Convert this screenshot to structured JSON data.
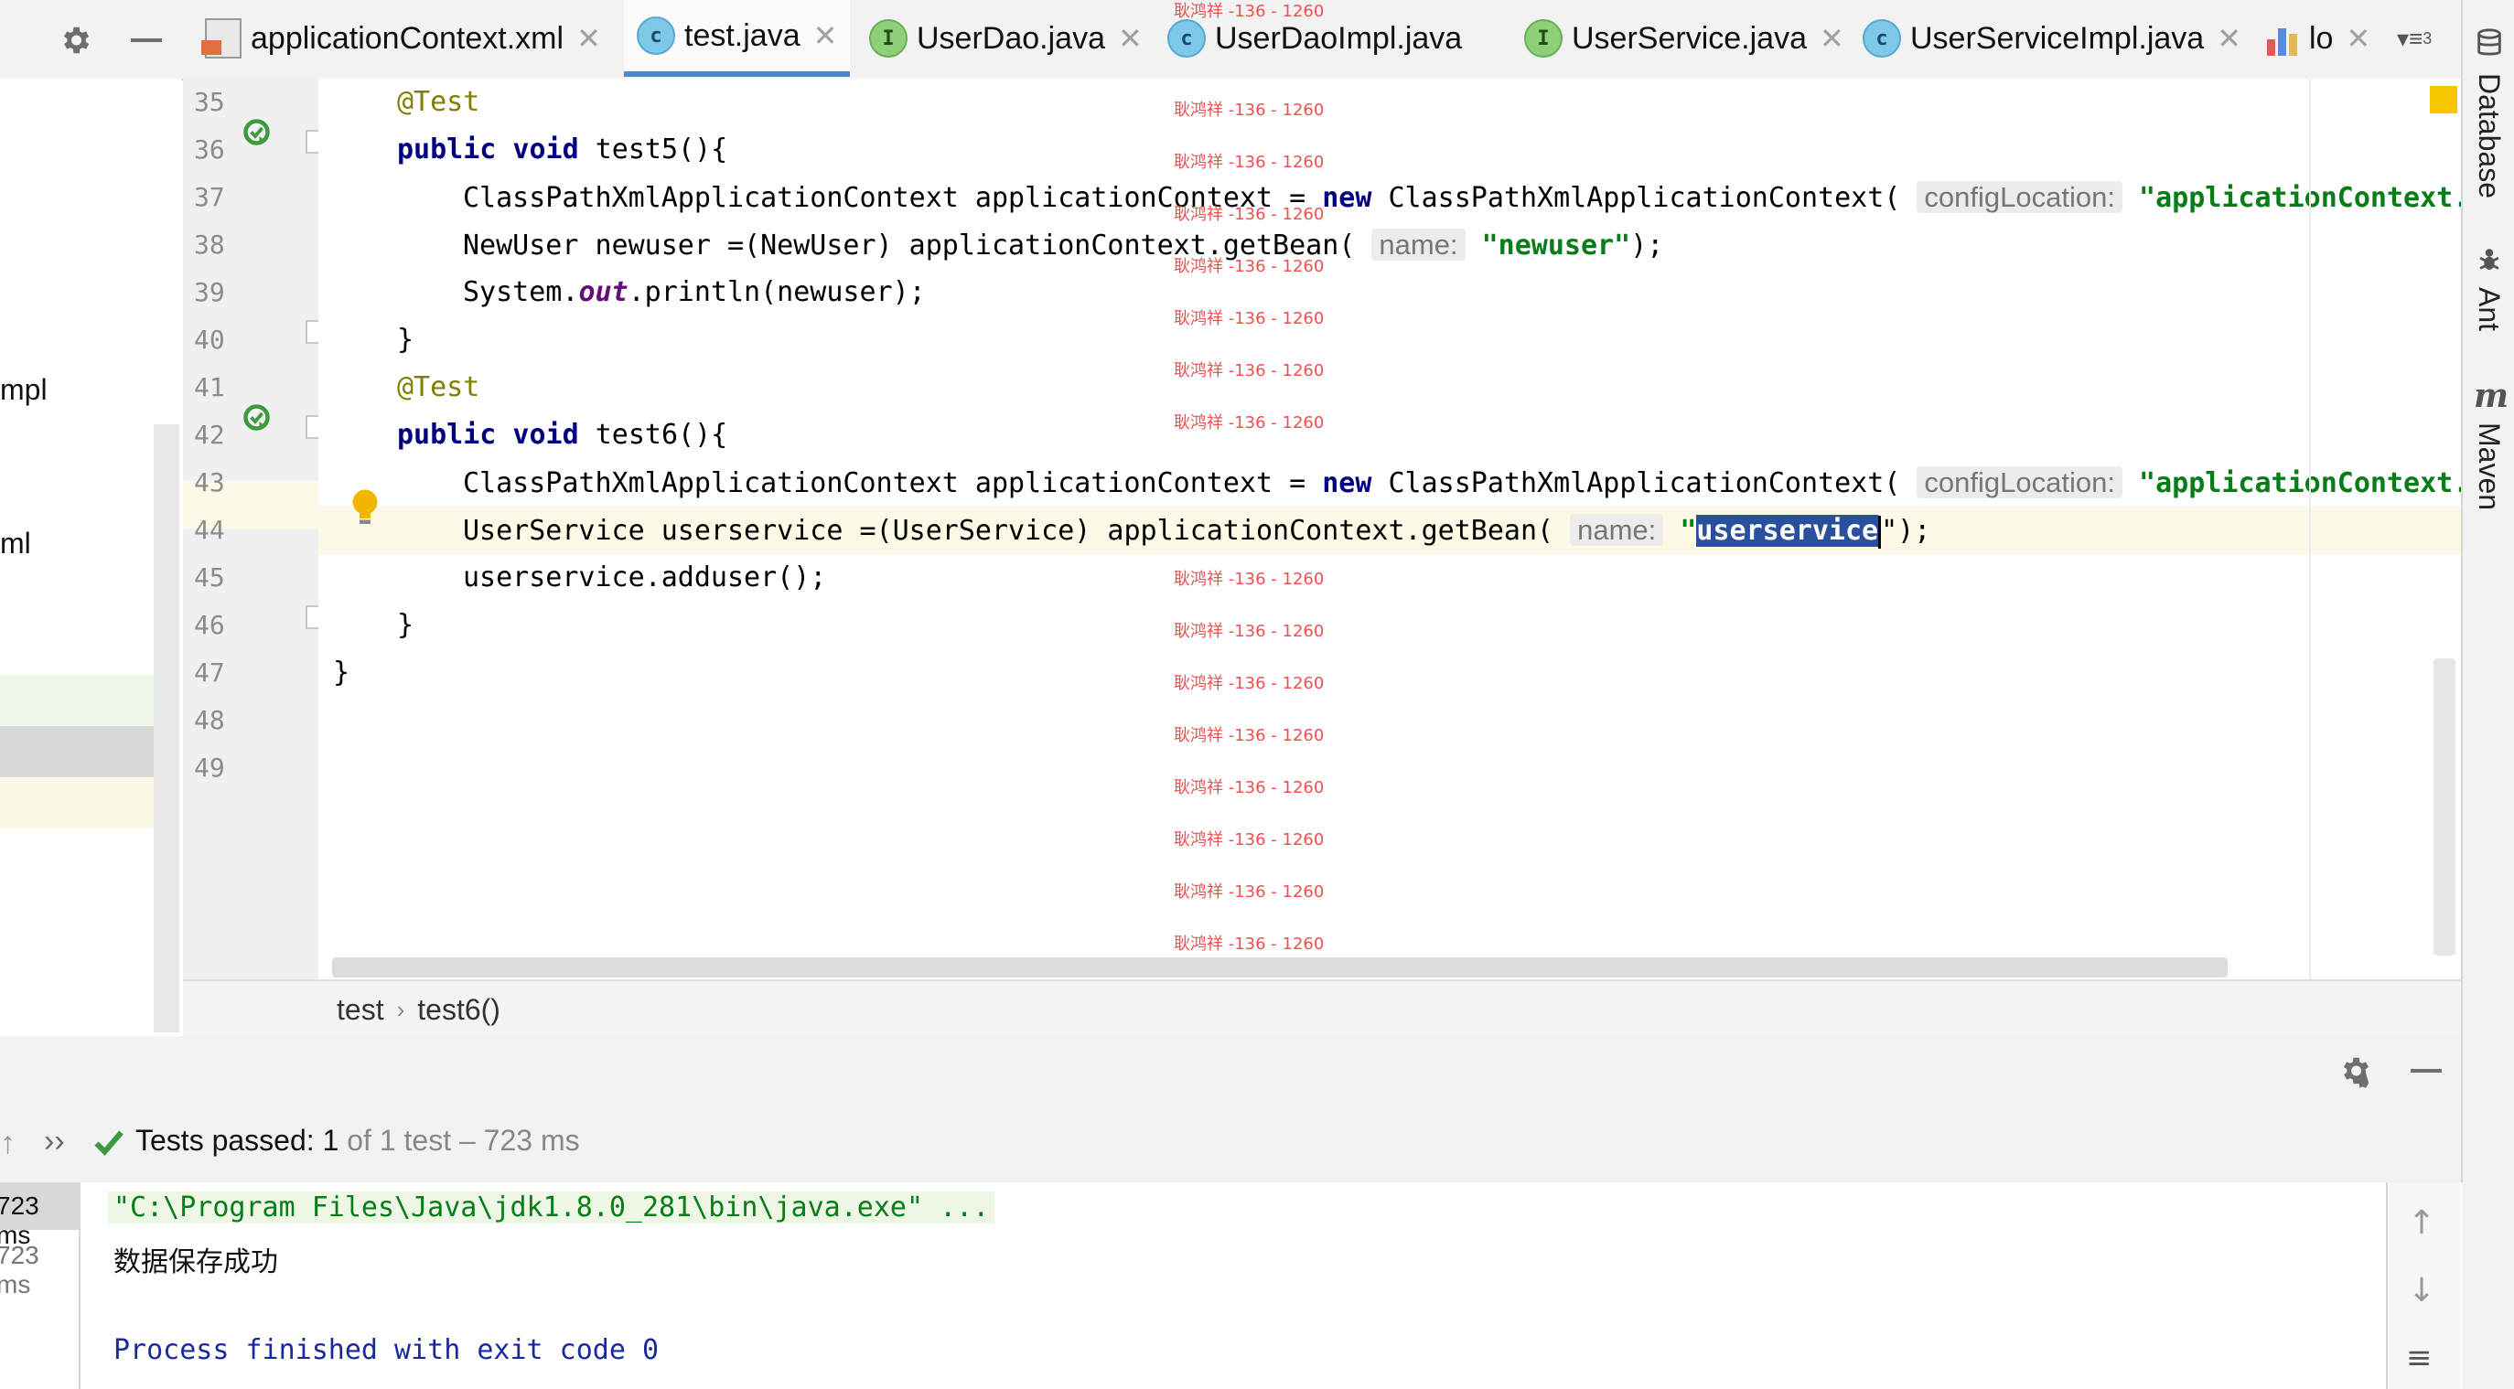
{
  "tabs": [
    {
      "label": "applicationContext.xml",
      "type": "xml"
    },
    {
      "label": "test.java",
      "type": "class",
      "active": true
    },
    {
      "label": "UserDao.java",
      "type": "interface"
    },
    {
      "label": "UserDaoImpl.java",
      "type": "class"
    },
    {
      "label": "UserService.java",
      "type": "interface"
    },
    {
      "label": "UserServiceImpl.java",
      "type": "class"
    },
    {
      "label": "lo",
      "type": "file"
    }
  ],
  "tab_overflow_count": "3",
  "project_fragments": [
    "mpl",
    "ml"
  ],
  "editor": {
    "line_numbers": [
      "35",
      "36",
      "37",
      "38",
      "39",
      "40",
      "41",
      "42",
      "43",
      "44",
      "45",
      "46",
      "47",
      "48",
      "49"
    ],
    "code": {
      "l35_ann": "@Test",
      "l36_kw": "public void",
      "l36_rest": " test5(){",
      "l37_a": "ClassPathXmlApplicationContext applicationContext = ",
      "l37_kw": "new",
      "l37_b": " ClassPathXmlApplicationContext( ",
      "l37_hint": "configLocation:",
      "l37_str": "\"applicationContext.",
      "l38_a": "NewUser newuser =(NewUser) applicationContext.getBean( ",
      "l38_hint": "name:",
      "l38_str": "\"newuser\"",
      "l38_end": ");",
      "l39_a": "System.",
      "l39_fld": "out",
      "l39_b": ".println(newuser);",
      "l40": "}",
      "l41_ann": "@Test",
      "l42_kw": "public void",
      "l42_rest": " test6(){",
      "l43_a": "ClassPathXmlApplicationContext applicationContext = ",
      "l43_kw": "new",
      "l43_b": " ClassPathXmlApplicationContext( ",
      "l43_hint": "configLocation:",
      "l43_str": "\"applicationContext.",
      "l44_a": "UserService userservice =(UserService) applicationContext.getBean( ",
      "l44_hint": "name:",
      "l44_q": "\"",
      "l44_sel": "userservice",
      "l44_end": "\");",
      "l45": "userservice.adduser();",
      "l46": "}",
      "l47": "}"
    },
    "watermark": "耿鸿祥 -136 - 1260"
  },
  "breadcrumb": {
    "class_name": "test",
    "separator": "›",
    "method": "test6()"
  },
  "right_tools": [
    "Database",
    "Ant",
    "Maven"
  ],
  "run": {
    "status_prefix": "Tests passed: ",
    "passed": "1",
    "status_suffix": " of 1 test – 723 ms",
    "tree_times": [
      "723 ms",
      "723 ms"
    ],
    "console_lines": [
      "\"C:\\Program Files\\Java\\jdk1.8.0_281\\bin\\java.exe\" ...",
      "数据保存成功",
      "",
      "Process finished with exit code 0"
    ]
  },
  "colors": {
    "accent": "#4a88c7",
    "keyword": "#000080",
    "string": "#067d17",
    "annotation": "#808000",
    "pass": "#3d9b3d"
  }
}
